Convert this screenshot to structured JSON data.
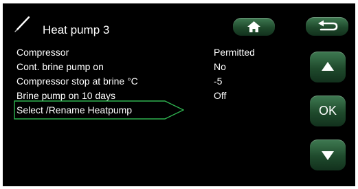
{
  "header": {
    "title": "Heat pump 3",
    "title_icon": "thermometer-probe-icon",
    "home_icon": "home-icon",
    "back_icon": "back-arrow-icon"
  },
  "menu": {
    "rows": [
      {
        "label": "Compressor",
        "value": "Permitted"
      },
      {
        "label": "Cont. brine pump on",
        "value": "No"
      },
      {
        "label": "Compressor stop at brine °C",
        "value": "-5"
      },
      {
        "label": "Brine pump on 10 days",
        "value": "Off"
      },
      {
        "label": "Select /Rename Heatpump",
        "value": ""
      }
    ],
    "selected_index": 4
  },
  "side_buttons": {
    "up_icon": "arrow-up-icon",
    "ok_label": "OK",
    "down_icon": "arrow-down-icon"
  },
  "colors": {
    "background": "#000000",
    "text": "#ffffff",
    "button_green": "#2e6a40",
    "highlight_green": "#2fb350"
  }
}
